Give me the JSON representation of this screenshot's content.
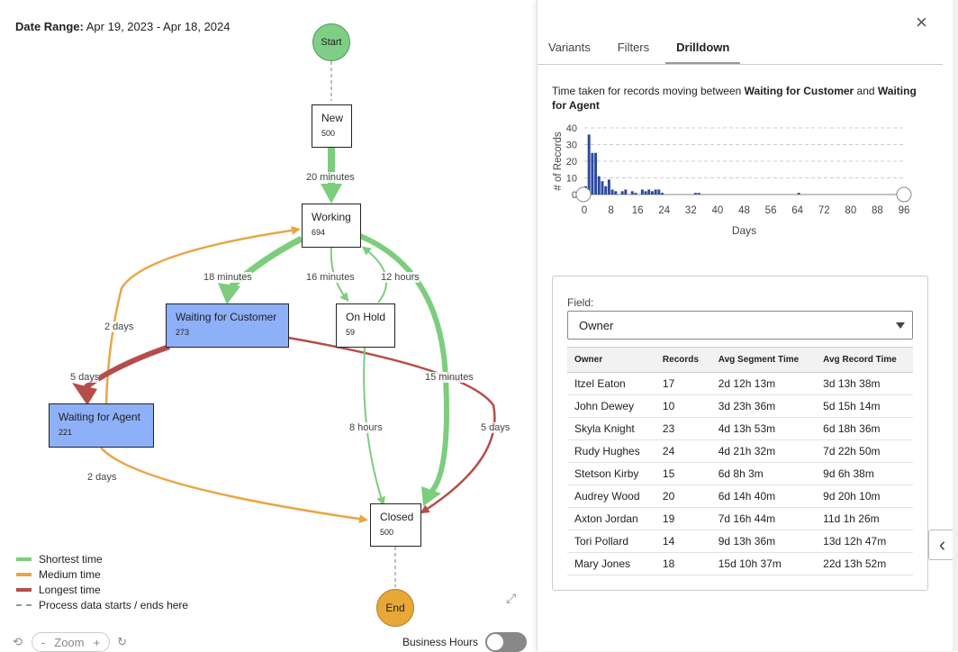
{
  "date_range": {
    "label": "Date Range:",
    "value": "Apr 19, 2023 - Apr 18, 2024"
  },
  "flow": {
    "start": "Start",
    "end": "End",
    "nodes": {
      "new": {
        "name": "New",
        "count": "500"
      },
      "working": {
        "name": "Working",
        "count": "694"
      },
      "waiting_customer": {
        "name": "Waiting for Customer",
        "count": "273"
      },
      "on_hold": {
        "name": "On Hold",
        "count": "59"
      },
      "waiting_agent": {
        "name": "Waiting for Agent",
        "count": "221"
      },
      "closed": {
        "name": "Closed",
        "count": "500"
      }
    },
    "edges": {
      "new_working": "20 minutes",
      "working_waitcust": "18 minutes",
      "working_onhold": "16 minutes",
      "onhold_working": "12 hours",
      "waitagent_working": "2 days",
      "waitcust_waitagent": "5 days",
      "waitcust_closed": "15 minutes",
      "onhold_closed": "8 hours",
      "waitcust_closed_long": "5 days",
      "waitagent_closed": "2 days"
    },
    "colors": {
      "shortest": "#7ccd7c",
      "medium": "#e9a546",
      "longest": "#b64d4a"
    }
  },
  "legend": {
    "shortest": "Shortest time",
    "medium": "Medium time",
    "longest": "Longest time",
    "boundary": "Process data starts / ends here"
  },
  "zoom": {
    "minus": "-",
    "label": "Zoom",
    "plus": "+"
  },
  "business_hours": "Business Hours",
  "panel": {
    "close": "×",
    "tabs": [
      "Variants",
      "Filters",
      "Drilldown"
    ],
    "caption": {
      "prefix": "Time taken for records moving between ",
      "from": "Waiting for Customer",
      "mid": " and ",
      "to": "Waiting for Agent"
    },
    "field_label": "Field:",
    "field_value": "Owner",
    "table": {
      "headers": [
        "Owner",
        "Records",
        "Avg Segment Time",
        "Avg Record Time"
      ],
      "rows": [
        [
          "Itzel Eaton",
          "17",
          "2d 12h 13m",
          "3d 13h 38m"
        ],
        [
          "John Dewey",
          "10",
          "3d 23h 36m",
          "5d 15h 14m"
        ],
        [
          "Skyla Knight",
          "23",
          "4d 13h 53m",
          "6d 18h 36m"
        ],
        [
          "Rudy Hughes",
          "24",
          "4d 21h 32m",
          "7d 22h 50m"
        ],
        [
          "Stetson Kirby",
          "15",
          "6d 8h 3m",
          "9d 6h 38m"
        ],
        [
          "Audrey Wood",
          "20",
          "6d 14h 40m",
          "9d 20h 10m"
        ],
        [
          "Axton Jordan",
          "19",
          "7d 16h 44m",
          "11d 1h 26m"
        ],
        [
          "Tori Pollard",
          "14",
          "9d 13h 36m",
          "13d 12h 47m"
        ],
        [
          "Mary Jones",
          "18",
          "15d 10h 37m",
          "22d 13h 52m"
        ]
      ]
    }
  },
  "chart_data": {
    "type": "bar",
    "xlabel": "Days",
    "ylabel": "# of Records",
    "xlim": [
      0,
      96
    ],
    "ylim": [
      0,
      40
    ],
    "xticks": [
      0,
      8,
      16,
      24,
      32,
      40,
      48,
      56,
      64,
      72,
      80,
      88,
      96
    ],
    "yticks": [
      0,
      10,
      20,
      30,
      40
    ],
    "grid": true,
    "bar_color": "#2d4a9e",
    "x": [
      0,
      1,
      2,
      3,
      4,
      5,
      6,
      7,
      8,
      9,
      11,
      12,
      14,
      15,
      17,
      18,
      19,
      20,
      21,
      22,
      23,
      33,
      34,
      64
    ],
    "values": [
      5,
      36,
      25,
      25,
      11,
      8,
      5,
      9,
      3,
      2,
      2,
      3,
      2,
      1,
      3,
      2,
      3,
      2,
      3,
      3,
      1,
      1,
      1,
      1
    ]
  }
}
